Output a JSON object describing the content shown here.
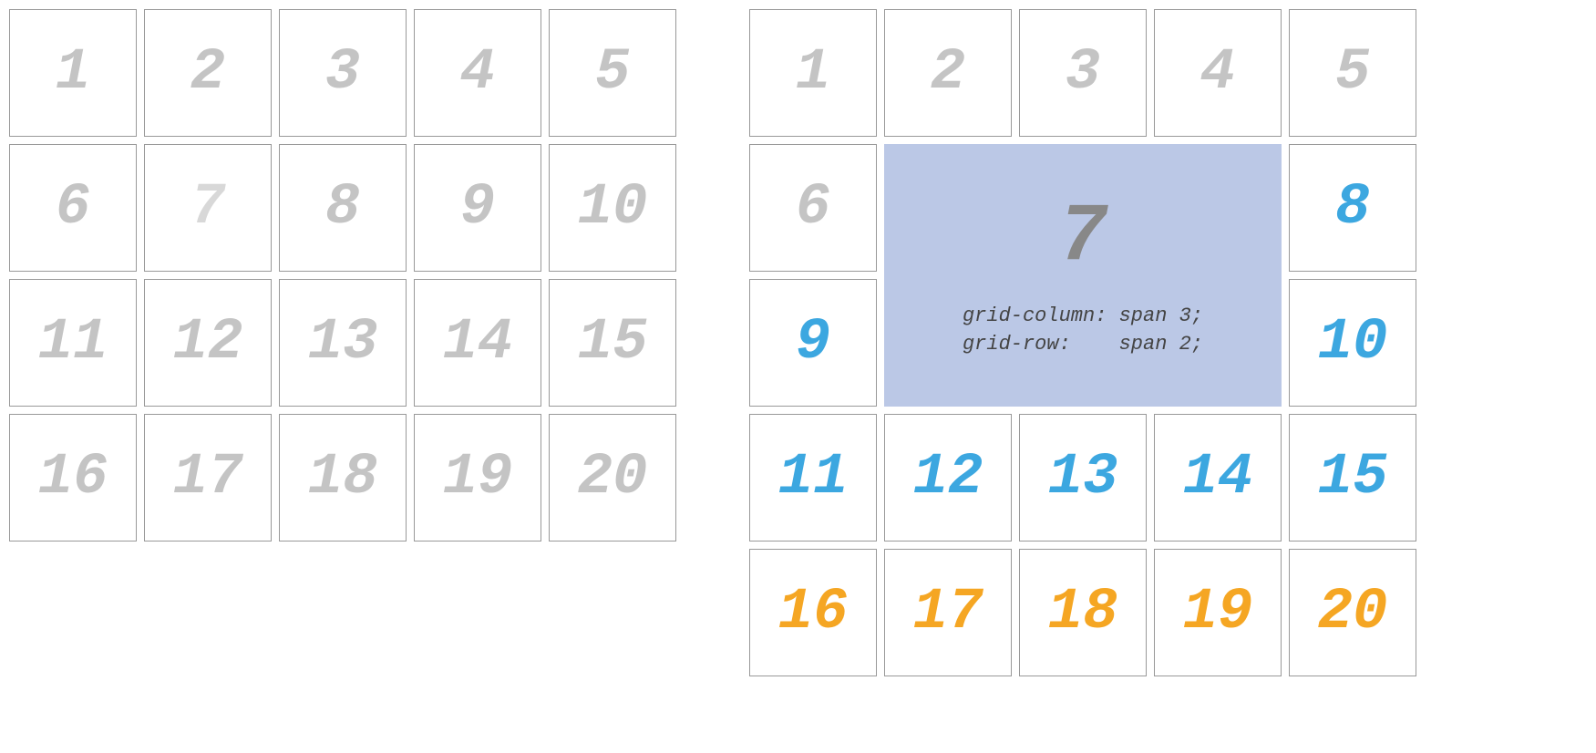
{
  "left": {
    "cells": [
      {
        "n": "1",
        "cls": "grey"
      },
      {
        "n": "2",
        "cls": "grey"
      },
      {
        "n": "3",
        "cls": "grey"
      },
      {
        "n": "4",
        "cls": "grey"
      },
      {
        "n": "5",
        "cls": "grey"
      },
      {
        "n": "6",
        "cls": "grey"
      },
      {
        "n": "7",
        "cls": "dim-grey"
      },
      {
        "n": "8",
        "cls": "grey"
      },
      {
        "n": "9",
        "cls": "grey"
      },
      {
        "n": "10",
        "cls": "grey"
      },
      {
        "n": "11",
        "cls": "grey"
      },
      {
        "n": "12",
        "cls": "grey"
      },
      {
        "n": "13",
        "cls": "grey"
      },
      {
        "n": "14",
        "cls": "grey"
      },
      {
        "n": "15",
        "cls": "grey"
      },
      {
        "n": "16",
        "cls": "grey"
      },
      {
        "n": "17",
        "cls": "grey"
      },
      {
        "n": "18",
        "cls": "grey"
      },
      {
        "n": "19",
        "cls": "grey"
      },
      {
        "n": "20",
        "cls": "grey"
      }
    ]
  },
  "right": {
    "span_number": "7",
    "code_line1": "grid-column: span 3;",
    "code_line2": "grid-row:    span 2;",
    "cells": [
      {
        "n": "1",
        "cls": "grey"
      },
      {
        "n": "2",
        "cls": "grey"
      },
      {
        "n": "3",
        "cls": "grey"
      },
      {
        "n": "4",
        "cls": "grey"
      },
      {
        "n": "5",
        "cls": "grey"
      },
      {
        "n": "6",
        "cls": "grey"
      },
      {
        "span": true
      },
      {
        "n": "8",
        "cls": "blue"
      },
      {
        "n": "9",
        "cls": "blue"
      },
      {
        "n": "10",
        "cls": "blue"
      },
      {
        "n": "11",
        "cls": "blue"
      },
      {
        "n": "12",
        "cls": "blue"
      },
      {
        "n": "13",
        "cls": "blue"
      },
      {
        "n": "14",
        "cls": "blue"
      },
      {
        "n": "15",
        "cls": "blue"
      },
      {
        "n": "16",
        "cls": "orange"
      },
      {
        "n": "17",
        "cls": "orange"
      },
      {
        "n": "18",
        "cls": "orange"
      },
      {
        "n": "19",
        "cls": "orange"
      },
      {
        "n": "20",
        "cls": "orange"
      }
    ]
  }
}
